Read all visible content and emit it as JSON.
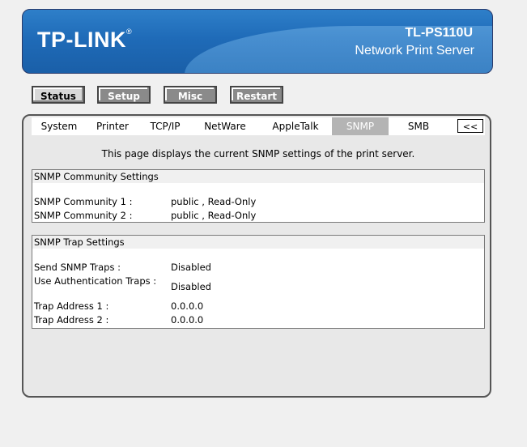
{
  "header": {
    "logo": "TP-LINK",
    "logo_mark": "®",
    "model": "TL-PS110U",
    "subtitle": "Network Print Server"
  },
  "top_buttons": [
    {
      "label": "Status",
      "state": "active"
    },
    {
      "label": "Setup",
      "state": "inactive"
    },
    {
      "label": "Misc",
      "state": "inactive"
    },
    {
      "label": "Restart",
      "state": "inactive"
    }
  ],
  "tabs": [
    {
      "label": "System"
    },
    {
      "label": "Printer"
    },
    {
      "label": "TCP/IP"
    },
    {
      "label": "NetWare"
    },
    {
      "label": "AppleTalk"
    },
    {
      "label": "SNMP",
      "selected": true
    },
    {
      "label": "SMB"
    }
  ],
  "tab_back_label": "<<",
  "intro": "This page displays the current SNMP settings of the print server.",
  "community": {
    "title": "SNMP Community Settings",
    "rows": [
      {
        "key": "SNMP Community 1 :",
        "value": "public , Read-Only"
      },
      {
        "key": "SNMP Community 2 :",
        "value": "public , Read-Only"
      }
    ]
  },
  "trap": {
    "title": "SNMP Trap Settings",
    "rows": [
      {
        "key": "Send SNMP Traps :",
        "value": "Disabled"
      },
      {
        "key": "Use Authentication Traps :",
        "value": "Disabled"
      },
      {
        "key": "Trap Address 1 :",
        "value": "0.0.0.0"
      },
      {
        "key": "Trap Address 2 :",
        "value": "0.0.0.0"
      }
    ]
  },
  "colors": {
    "banner": "#1f6bb8",
    "selected_tab": "#b4b4b4"
  }
}
